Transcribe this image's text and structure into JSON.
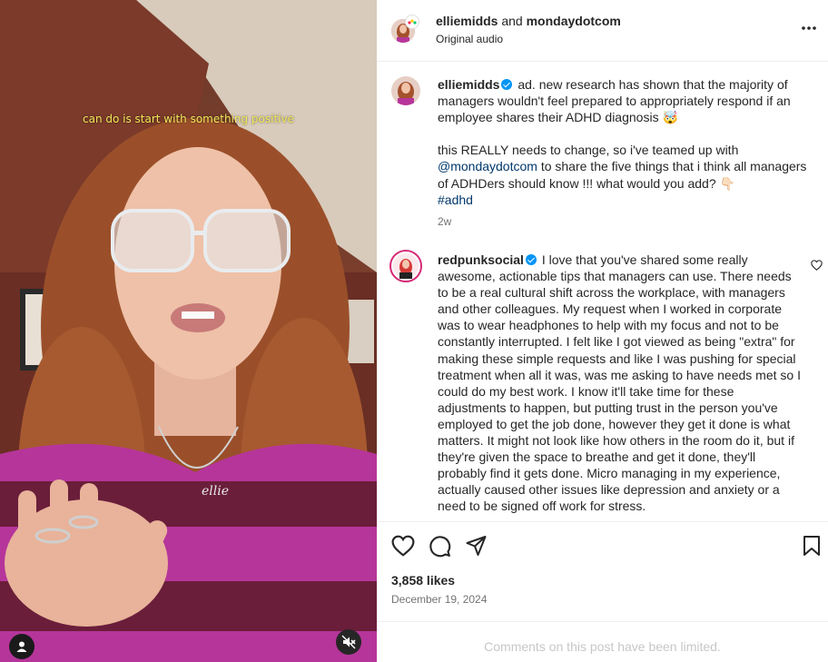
{
  "video": {
    "caption": "can do is start with something positive"
  },
  "header": {
    "user1": "elliemidds",
    "joiner": "and",
    "user2": "mondaydotcom",
    "audio": "Original audio"
  },
  "caption_comment": {
    "username": "elliemidds",
    "text1": "ad. new research has shown that the majority of managers wouldn't feel prepared to appropriately respond if an employee shares their ADHD diagnosis 🤯",
    "text2a": "this REALLY needs to change, so i've teamed up with ",
    "mention": "@mondaydotcom",
    "text2b": " to share the five things that i think all managers of ADHDers should know !!! what would you add? 👇🏻",
    "hashtag": "#adhd",
    "age": "2w"
  },
  "comment": {
    "username": "redpunksocial",
    "text": "I love that you've shared some really awesome, actionable tips that managers can use. There needs to be a real cultural shift across the workplace, with managers and other colleagues. My request when I worked in corporate was to wear headphones to help with my focus and not to be constantly interrupted. I felt like I got viewed as being \"extra\" for making these simple requests and like I was pushing for special treatment when all it was, was me asking to have needs met so I could do my best work. I know it'll take time for these adjustments to happen, but putting trust in the person you've employed to get the job done, however they get it done is what matters. It might not look like how others in the room do it, but if they're given the space to breathe and get it done, they'll probably find it gets done. Micro managing in my experience, actually caused other issues like depression and anxiety or a need to be signed off work for stress."
  },
  "post": {
    "likes": "3,858 likes",
    "date": "December 19, 2024",
    "comments_limited": "Comments on this post have been limited."
  },
  "icons": [
    "user-tag-icon",
    "mute-icon",
    "more-icon",
    "verified-icon",
    "heart-icon",
    "comment-icon",
    "share-icon",
    "save-icon"
  ],
  "colors": {
    "link": "#00376b",
    "verified": "#0095f6",
    "caption_text": "#f2e85a"
  }
}
